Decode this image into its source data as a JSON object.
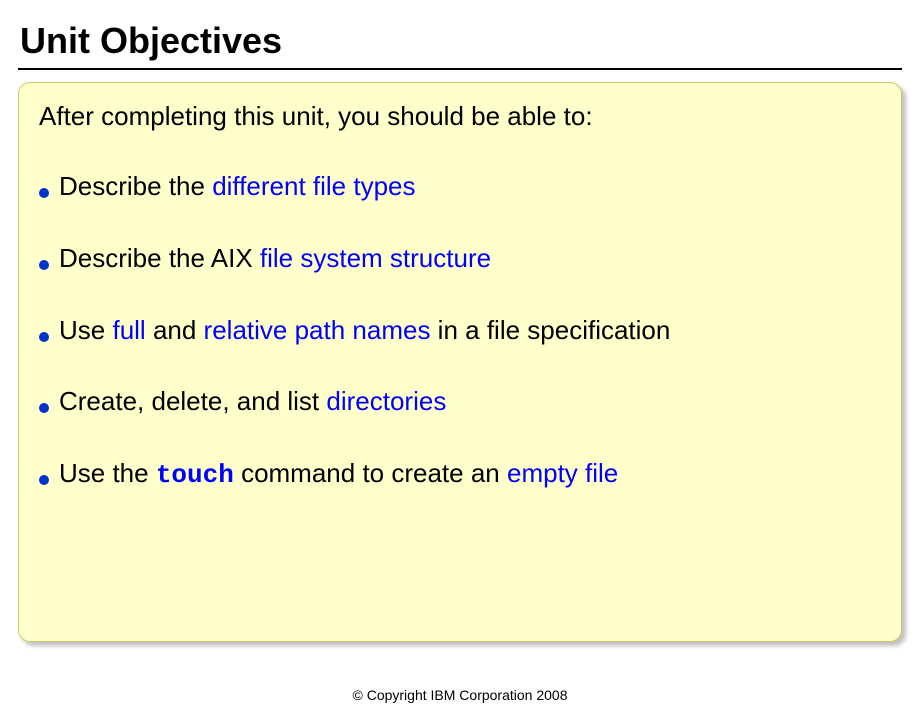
{
  "title": "Unit Objectives",
  "intro": "After completing this unit, you should be able to:",
  "bullets": {
    "b1": {
      "p1": "Describe the ",
      "h1": "different file types"
    },
    "b2": {
      "p1": "Describe the AIX ",
      "h1": "file system structure"
    },
    "b3": {
      "p1": "Use ",
      "h1": "full",
      "p2": " and ",
      "h2": "relative path names",
      "p3": " in a file specification"
    },
    "b4": {
      "p1": "Create, delete, and list ",
      "h1": "directories"
    },
    "b5": {
      "p1": "Use the ",
      "c1": "touch",
      "p2": " command to create an ",
      "h1": "empty file"
    }
  },
  "footer": "© Copyright IBM Corporation 2008"
}
